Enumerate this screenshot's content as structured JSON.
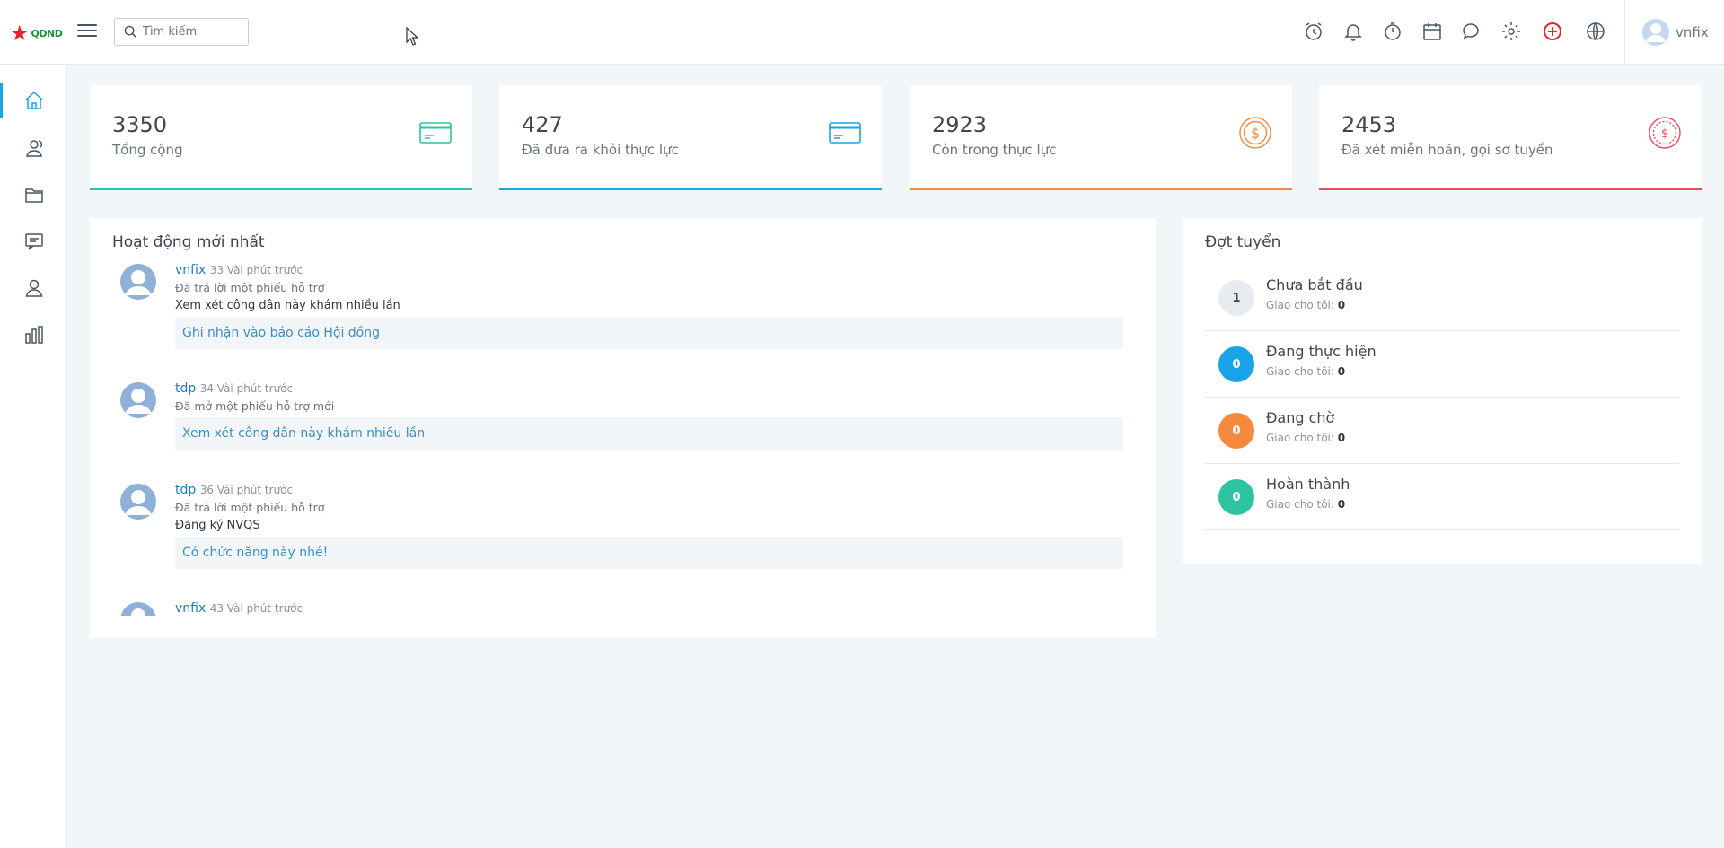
{
  "brand": {
    "logo_text": "QDND"
  },
  "search": {
    "placeholder": "Tìm kiếm"
  },
  "user": {
    "name": "vnfix"
  },
  "top_icons": [
    "alarm-icon",
    "bell-icon",
    "timer-icon",
    "calendar-icon",
    "chat-icon",
    "gear-icon",
    "add-circle-icon",
    "globe-icon"
  ],
  "sidebar": {
    "items": [
      "home-icon",
      "users-icon",
      "folder-icon",
      "comments-icon",
      "user-icon",
      "bar-chart-icon"
    ]
  },
  "stats": [
    {
      "value": "3350",
      "label": "Tổng cộng",
      "icon": "card-icon",
      "color": "#2ec4a1"
    },
    {
      "value": "427",
      "label": "Đã đưa ra khỏi thực lực",
      "icon": "card-icon",
      "color": "#1aa3e8"
    },
    {
      "value": "2923",
      "label": "Còn trong thực lực",
      "icon": "dollar-coin-icon",
      "color": "#f58a3e"
    },
    {
      "value": "2453",
      "label": "Đã xét miễn hoãn, gọi sơ tuyển",
      "icon": "dollar-dotted-icon",
      "color": "#ee4c5c"
    }
  ],
  "activity": {
    "title": "Hoạt động mới nhất",
    "items": [
      {
        "user": "vnfix",
        "time": "33 Vài phút trước",
        "action": "Đã trả lời một phiếu hỗ trợ",
        "subject": "Xem xét công dân này khám nhiều lần",
        "quote": "Ghi nhận vào báo cáo Hội đồng"
      },
      {
        "user": "tdp",
        "time": "34 Vài phút trước",
        "action": "Đã mở một phiếu hỗ trợ mới",
        "subject": "",
        "quote": "Xem xét công dân này khám nhiều lần"
      },
      {
        "user": "tdp",
        "time": "36 Vài phút trước",
        "action": "Đã trả lời một phiếu hỗ trợ",
        "subject": "Đăng ký NVQS",
        "quote": "Có chức năng này nhé!"
      },
      {
        "user": "vnfix",
        "time": "43 Vài phút trước",
        "action": "",
        "subject": "",
        "quote": ""
      }
    ]
  },
  "dot_tuyen": {
    "title": "Đợt tuyển",
    "assigned_label": "Giao cho tôi:",
    "items": [
      {
        "count": "1",
        "name": "Chưa bắt đầu",
        "assigned": "0",
        "color": "#e8ebef"
      },
      {
        "count": "0",
        "name": "Đang thực hiện",
        "assigned": "0",
        "color": "#1aa3e8"
      },
      {
        "count": "0",
        "name": "Đang chờ",
        "assigned": "0",
        "color": "#f58a3e"
      },
      {
        "count": "0",
        "name": "Hoàn thành",
        "assigned": "0",
        "color": "#2ec4a1"
      }
    ]
  }
}
